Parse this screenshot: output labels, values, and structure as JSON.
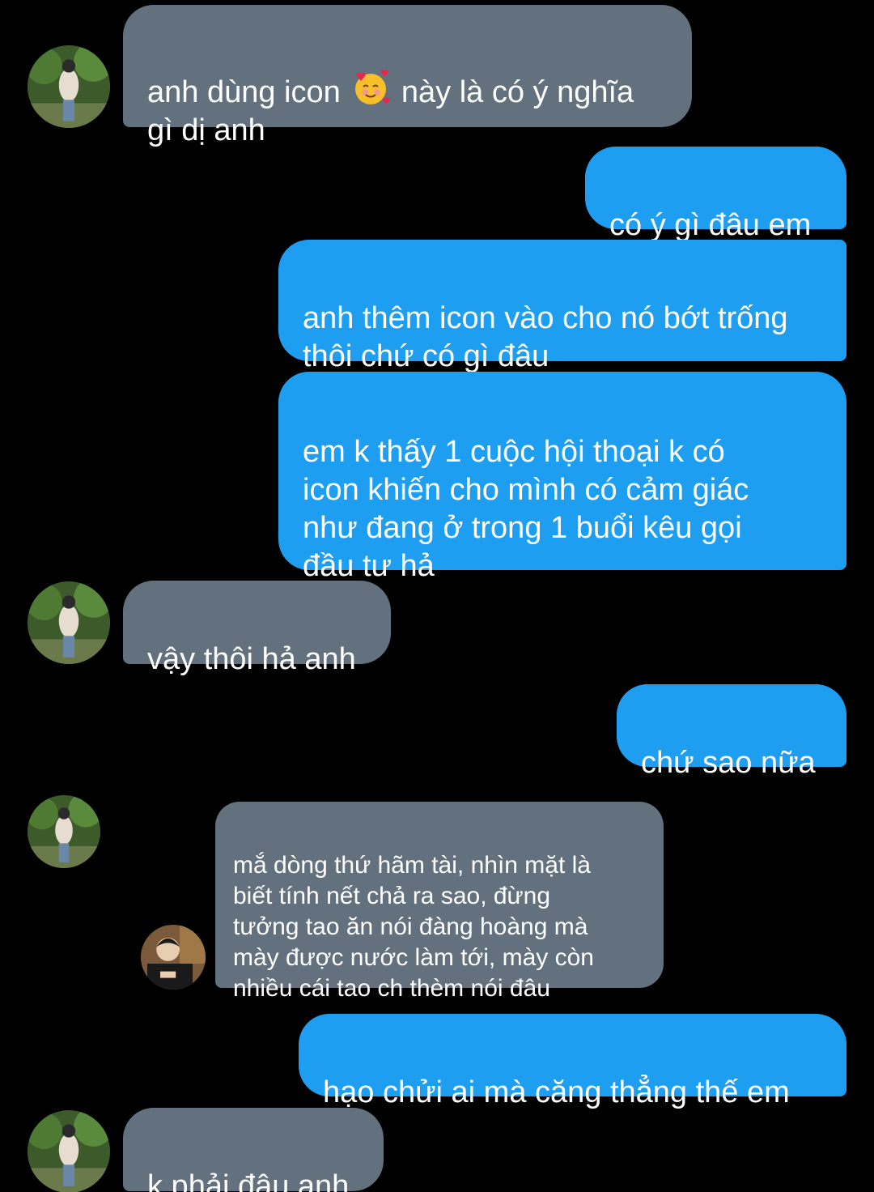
{
  "messages": [
    {
      "id": 1,
      "side": "in",
      "text_before": "anh dùng icon ",
      "emoji": "smiling-face-with-hearts-icon",
      "text_after": " này là có ý nghĩa\ngì dị anh"
    },
    {
      "id": 2,
      "side": "out",
      "text": "có ý gì đâu em"
    },
    {
      "id": 3,
      "side": "out",
      "text": "anh thêm icon vào cho nó bớt trống\nthôi chứ có gì đâu"
    },
    {
      "id": 4,
      "side": "out",
      "text": "em k thấy 1 cuộc hội thoại k có\nicon khiến cho mình có cảm giác\nnhư đang ở trong 1 buổi kêu gọi\nđầu tư hả"
    },
    {
      "id": 5,
      "side": "in",
      "text": "vậy thôi hả anh"
    },
    {
      "id": 6,
      "side": "out",
      "text": "chứ sao nữa"
    },
    {
      "id": 7,
      "side": "in",
      "type": "quoted",
      "text": "mắ dòng thứ hãm tài, nhìn mặt là\nbiết tính nết chả ra sao, đừng\ntưởng tao ăn nói đàng hoàng mà\nmày được nước làm tới, mày còn\nnhiều cái tao ch thèm nói đâu"
    },
    {
      "id": 8,
      "side": "out",
      "text": "hạo chửi ai mà căng thẳng thế em"
    },
    {
      "id": 9,
      "side": "in",
      "text": "k phải đâu anh"
    }
  ],
  "colors": {
    "background": "#000000",
    "incoming_bubble": "#63717f",
    "outgoing_bubble": "#1e9ef0",
    "text": "#ffffff"
  },
  "icons": {
    "contact_avatar": "contact-avatar",
    "quoted_avatar": "quoted-sender-avatar"
  }
}
